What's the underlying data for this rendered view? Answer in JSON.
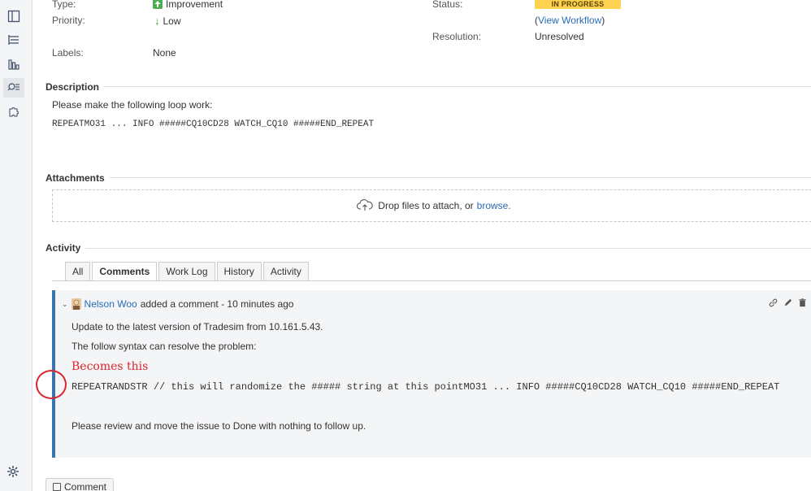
{
  "fields": {
    "type_label": "Type:",
    "type_value": "Improvement",
    "priority_label": "Priority:",
    "priority_value": "Low",
    "labels_label": "Labels:",
    "labels_value": "None",
    "status_label": "Status:",
    "status_value": "IN PROGRESS",
    "view_workflow": "View Workflow",
    "resolution_label": "Resolution:",
    "resolution_value": "Unresolved"
  },
  "description": {
    "title": "Description",
    "line1": "Please make the following loop work:",
    "code": "REPEATMO31 ... INFO #####CQ10CD28 WATCH_CQ10 #####END_REPEAT"
  },
  "attachments": {
    "title": "Attachments",
    "drop_text": "Drop files to attach, or",
    "browse": "browse."
  },
  "activity": {
    "title": "Activity",
    "tabs": [
      "All",
      "Comments",
      "Work Log",
      "History",
      "Activity"
    ],
    "active_tab": "Comments"
  },
  "comment": {
    "author": "Nelson Woo",
    "action": "added a comment - 10 minutes ago",
    "line1": "Update to the latest version of Tradesim from 10.161.5.43.",
    "line2": "The follow syntax can resolve the problem:",
    "annotation": "Becomes this",
    "code": "REPEATRANDSTR   // this will randomize the ##### string at this pointMO31 ... INFO #####CQ10CD28 WATCH_CQ10 #####END_REPEAT",
    "line3": "Please review and move the issue to Done with nothing to follow up."
  },
  "footer": {
    "comment_button": "Comment"
  },
  "colors": {
    "status": "#ffd351",
    "link": "#2a6cb5",
    "comment_bar": "#3b73af",
    "annotation": "#d9252b"
  },
  "icons": [
    "panel-icon",
    "backlog-icon",
    "reports-icon",
    "issues-search-icon",
    "addons-icon",
    "settings-gear-icon"
  ]
}
